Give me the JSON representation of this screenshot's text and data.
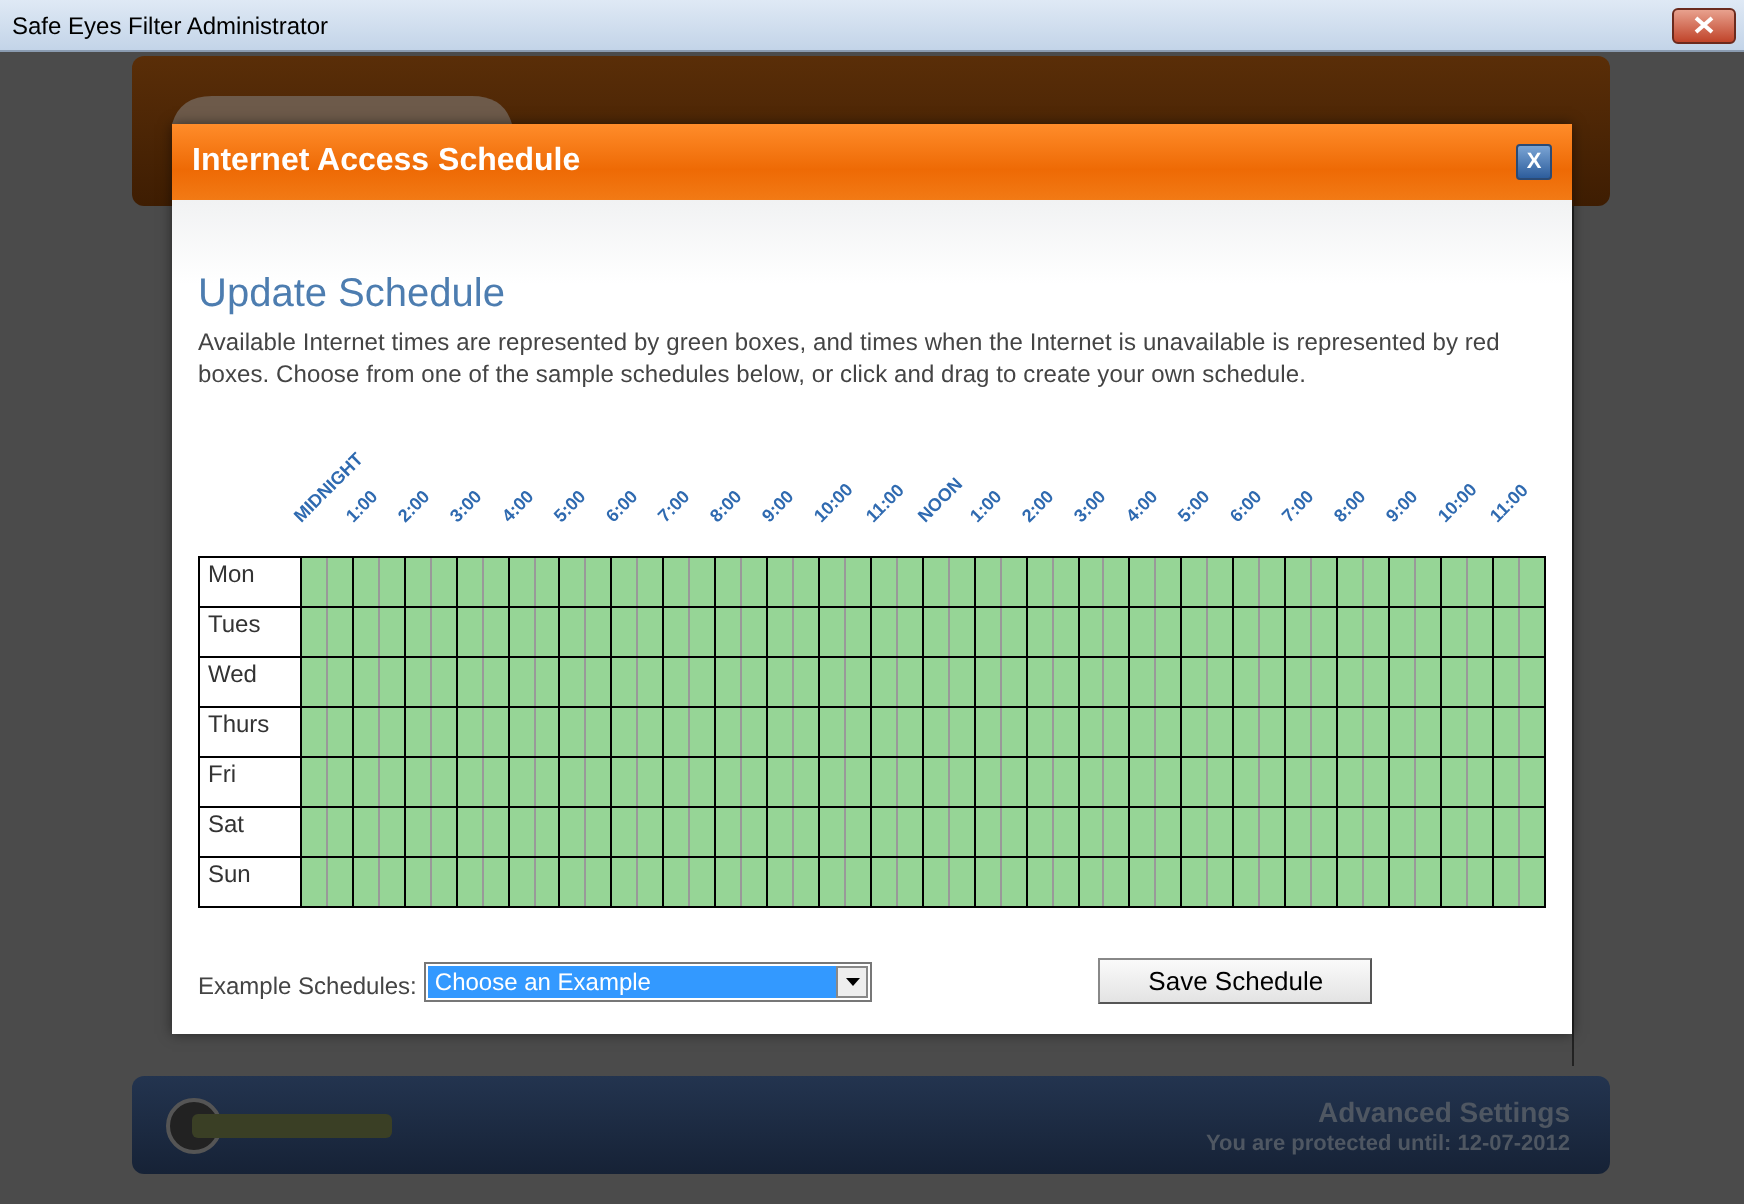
{
  "window": {
    "title": "Safe Eyes Filter Administrator"
  },
  "footer": {
    "heading": "Advanced Settings",
    "status": "You are protected until: 12-07-2012"
  },
  "dialog": {
    "title": "Internet Access Schedule",
    "close": "X",
    "heading": "Update Schedule",
    "description": "Available Internet times are represented by green boxes, and times when the Internet is unavailable is represented by red boxes. Choose from one of the sample schedules below, or click and drag to create your own schedule.",
    "hours": [
      "MIDNIGHT",
      "1:00",
      "2:00",
      "3:00",
      "4:00",
      "5:00",
      "6:00",
      "7:00",
      "8:00",
      "9:00",
      "10:00",
      "11:00",
      "NOON",
      "1:00",
      "2:00",
      "3:00",
      "4:00",
      "5:00",
      "6:00",
      "7:00",
      "8:00",
      "9:00",
      "10:00",
      "11:00"
    ],
    "days": [
      {
        "label": "Mon",
        "available": [
          true,
          true,
          true,
          true,
          true,
          true,
          true,
          true,
          true,
          true,
          true,
          true,
          true,
          true,
          true,
          true,
          true,
          true,
          true,
          true,
          true,
          true,
          true,
          true,
          true,
          true,
          true,
          true,
          true,
          true,
          true,
          true,
          true,
          true,
          true,
          true,
          true,
          true,
          true,
          true,
          true,
          true,
          true,
          true,
          true,
          true,
          true,
          true
        ]
      },
      {
        "label": "Tues",
        "available": [
          true,
          true,
          true,
          true,
          true,
          true,
          true,
          true,
          true,
          true,
          true,
          true,
          true,
          true,
          true,
          true,
          true,
          true,
          true,
          true,
          true,
          true,
          true,
          true,
          true,
          true,
          true,
          true,
          true,
          true,
          true,
          true,
          true,
          true,
          true,
          true,
          true,
          true,
          true,
          true,
          true,
          true,
          true,
          true,
          true,
          true,
          true,
          true
        ]
      },
      {
        "label": "Wed",
        "available": [
          true,
          true,
          true,
          true,
          true,
          true,
          true,
          true,
          true,
          true,
          true,
          true,
          true,
          true,
          true,
          true,
          true,
          true,
          true,
          true,
          true,
          true,
          true,
          true,
          true,
          true,
          true,
          true,
          true,
          true,
          true,
          true,
          true,
          true,
          true,
          true,
          true,
          true,
          true,
          true,
          true,
          true,
          true,
          true,
          true,
          true,
          true,
          true
        ]
      },
      {
        "label": "Thurs",
        "available": [
          true,
          true,
          true,
          true,
          true,
          true,
          true,
          true,
          true,
          true,
          true,
          true,
          true,
          true,
          true,
          true,
          true,
          true,
          true,
          true,
          true,
          true,
          true,
          true,
          true,
          true,
          true,
          true,
          true,
          true,
          true,
          true,
          true,
          true,
          true,
          true,
          true,
          true,
          true,
          true,
          true,
          true,
          true,
          true,
          true,
          true,
          true,
          true
        ]
      },
      {
        "label": "Fri",
        "available": [
          true,
          true,
          true,
          true,
          true,
          true,
          true,
          true,
          true,
          true,
          true,
          true,
          true,
          true,
          true,
          true,
          true,
          true,
          true,
          true,
          true,
          true,
          true,
          true,
          true,
          true,
          true,
          true,
          true,
          true,
          true,
          true,
          true,
          true,
          true,
          true,
          true,
          true,
          true,
          true,
          true,
          true,
          true,
          true,
          true,
          true,
          true,
          true
        ]
      },
      {
        "label": "Sat",
        "available": [
          true,
          true,
          true,
          true,
          true,
          true,
          true,
          true,
          true,
          true,
          true,
          true,
          true,
          true,
          true,
          true,
          true,
          true,
          true,
          true,
          true,
          true,
          true,
          true,
          true,
          true,
          true,
          true,
          true,
          true,
          true,
          true,
          true,
          true,
          true,
          true,
          true,
          true,
          true,
          true,
          true,
          true,
          true,
          true,
          true,
          true,
          true,
          true
        ]
      },
      {
        "label": "Sun",
        "available": [
          true,
          true,
          true,
          true,
          true,
          true,
          true,
          true,
          true,
          true,
          true,
          true,
          true,
          true,
          true,
          true,
          true,
          true,
          true,
          true,
          true,
          true,
          true,
          true,
          true,
          true,
          true,
          true,
          true,
          true,
          true,
          true,
          true,
          true,
          true,
          true,
          true,
          true,
          true,
          true,
          true,
          true,
          true,
          true,
          true,
          true,
          true,
          true
        ]
      }
    ],
    "example_label": "Example Schedules:",
    "example_select": "Choose an Example",
    "save_button": "Save Schedule"
  }
}
